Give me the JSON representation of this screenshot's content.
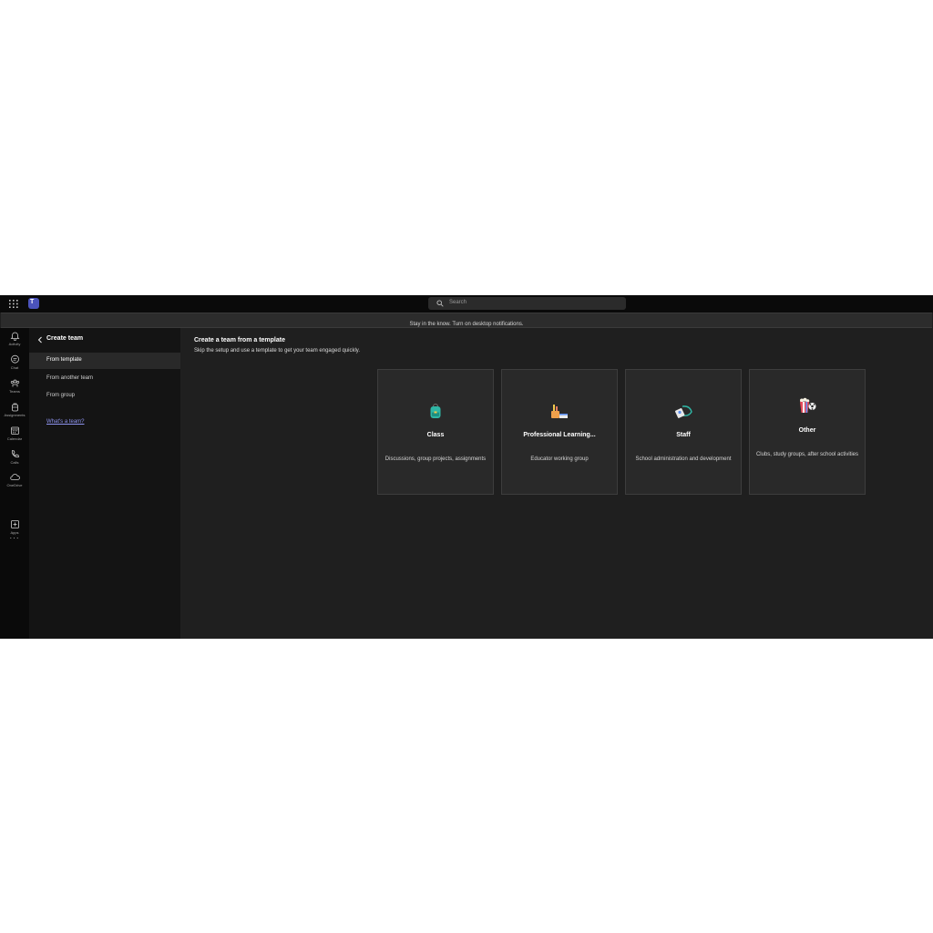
{
  "titlebar": {
    "search_placeholder": "Search",
    "logo_text": "T"
  },
  "notification": {
    "text": "Stay in the know. Turn on desktop notifications."
  },
  "rail": {
    "items": [
      {
        "label": "Activity",
        "icon": "bell-icon"
      },
      {
        "label": "Chat",
        "icon": "chat-icon"
      },
      {
        "label": "Teams",
        "icon": "teams-icon"
      },
      {
        "label": "Assignments",
        "icon": "backpack-icon"
      },
      {
        "label": "Calendar",
        "icon": "calendar-icon"
      },
      {
        "label": "Calls",
        "icon": "phone-icon"
      },
      {
        "label": "OneDrive",
        "icon": "cloud-icon"
      },
      {
        "label": "Apps",
        "icon": "plus-box-icon"
      }
    ],
    "more": "···"
  },
  "left_pane": {
    "title": "Create team",
    "items": [
      {
        "label": "From template",
        "active": true
      },
      {
        "label": "From another team",
        "active": false
      },
      {
        "label": "From group",
        "active": false
      }
    ],
    "link": "What's a team?"
  },
  "main": {
    "title": "Create a team from a template",
    "subtitle": "Skip the setup and use a template to get your team engaged quickly.",
    "cards": [
      {
        "title": "Class",
        "description": "Discussions, group projects, assignments",
        "icon": "backpack-icon"
      },
      {
        "title": "Professional Learning...",
        "description": "Educator working group",
        "icon": "pencil-cup-icon"
      },
      {
        "title": "Staff",
        "description": "School administration and development",
        "icon": "id-badge-icon"
      },
      {
        "title": "Other",
        "description": "Clubs, study groups, after school activities",
        "icon": "popcorn-ball-icon"
      }
    ]
  },
  "colors": {
    "accent": "#4b53bc",
    "link": "#8f94f0",
    "background": "#1f1f1f"
  }
}
